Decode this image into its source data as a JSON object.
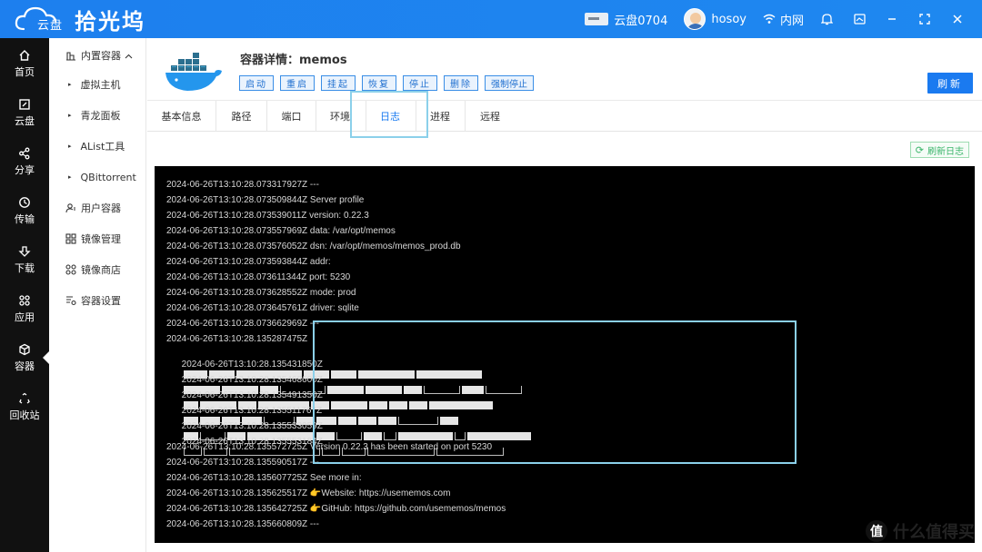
{
  "app": {
    "logo_cloud_text": "云盘",
    "title": "拾光坞"
  },
  "topbar": {
    "disk_label": "云盘0704",
    "user_name": "hosoy",
    "network_label": "内网",
    "icons": [
      "bell-icon",
      "screenshot-icon",
      "minimize-icon",
      "fullscreen-icon",
      "close-icon"
    ]
  },
  "leftnav": {
    "items": [
      {
        "label": "首页",
        "icon": "home-icon"
      },
      {
        "label": "云盘",
        "icon": "cloud-drive-icon"
      },
      {
        "label": "分享",
        "icon": "share-icon"
      },
      {
        "label": "传输",
        "icon": "transfer-icon"
      },
      {
        "label": "下载",
        "icon": "download-icon"
      },
      {
        "label": "应用",
        "icon": "apps-icon"
      },
      {
        "label": "容器",
        "icon": "container-icon"
      },
      {
        "label": "回收站",
        "icon": "recycle-icon"
      }
    ],
    "active": "容器"
  },
  "subnav": {
    "group_label": "内置容器",
    "group_items": [
      "虚拟主机",
      "青龙面板",
      "AList工具",
      "QBittorrent"
    ],
    "items": [
      {
        "label": "用户容器",
        "icon": "user-container-icon"
      },
      {
        "label": "镜像管理",
        "icon": "image-manage-icon"
      },
      {
        "label": "镜像商店",
        "icon": "image-store-icon"
      },
      {
        "label": "容器设置",
        "icon": "container-settings-icon"
      }
    ]
  },
  "detail": {
    "title": "容器详情：memos",
    "actions": [
      "启动",
      "重启",
      "挂起",
      "恢复",
      "停止",
      "删除",
      "强制停止"
    ],
    "refresh_label": "刷新"
  },
  "tabs": [
    "基本信息",
    "路径",
    "端口",
    "环境",
    "日志",
    "进程",
    "远程"
  ],
  "active_tab": "日志",
  "refresh_log_label": "刷新日志",
  "log": {
    "lines": [
      "2024-06-26T13:10:28.073317927Z ---",
      "2024-06-26T13:10:28.073509844Z Server profile",
      "2024-06-26T13:10:28.073539011Z version: 0.22.3",
      "2024-06-26T13:10:28.073557969Z data: /var/opt/memos",
      "2024-06-26T13:10:28.073576052Z dsn: /var/opt/memos/memos_prod.db",
      "2024-06-26T13:10:28.073593844Z addr:",
      "2024-06-26T13:10:28.073611344Z port: 5230",
      "2024-06-26T13:10:28.073628552Z mode: prod",
      "2024-06-26T13:10:28.073645761Z driver: sqlite",
      "2024-06-26T13:10:28.073662969Z ---",
      "2024-06-26T13:10:28.135287475Z",
      "2024-06-26T13:10:28.135431850Z",
      "2024-06-26T13:10:28.135468600Z",
      "2024-06-26T13:10:28.135491350Z",
      "2024-06-26T13:10:28.135511767Z",
      "2024-06-26T13:10:28.135533059Z",
      "2024-06-26T13:10:28.135553184Z",
      "2024-06-26T13:10:28.135572725Z Version 0.22.3 has been started on port 5230",
      "2024-06-26T13:10:28.135590517Z ---",
      "2024-06-26T13:10:28.135607725Z See more in:",
      "2024-06-26T13:10:28.135625517Z 👉Website: https://usememos.com",
      "2024-06-26T13:10:28.135642725Z 👉GitHub: https://github.com/usememos/memos",
      "2024-06-26T13:10:28.135660809Z ---"
    ]
  },
  "watermark": {
    "circle_glyph": "值",
    "text": "什么值得买"
  }
}
